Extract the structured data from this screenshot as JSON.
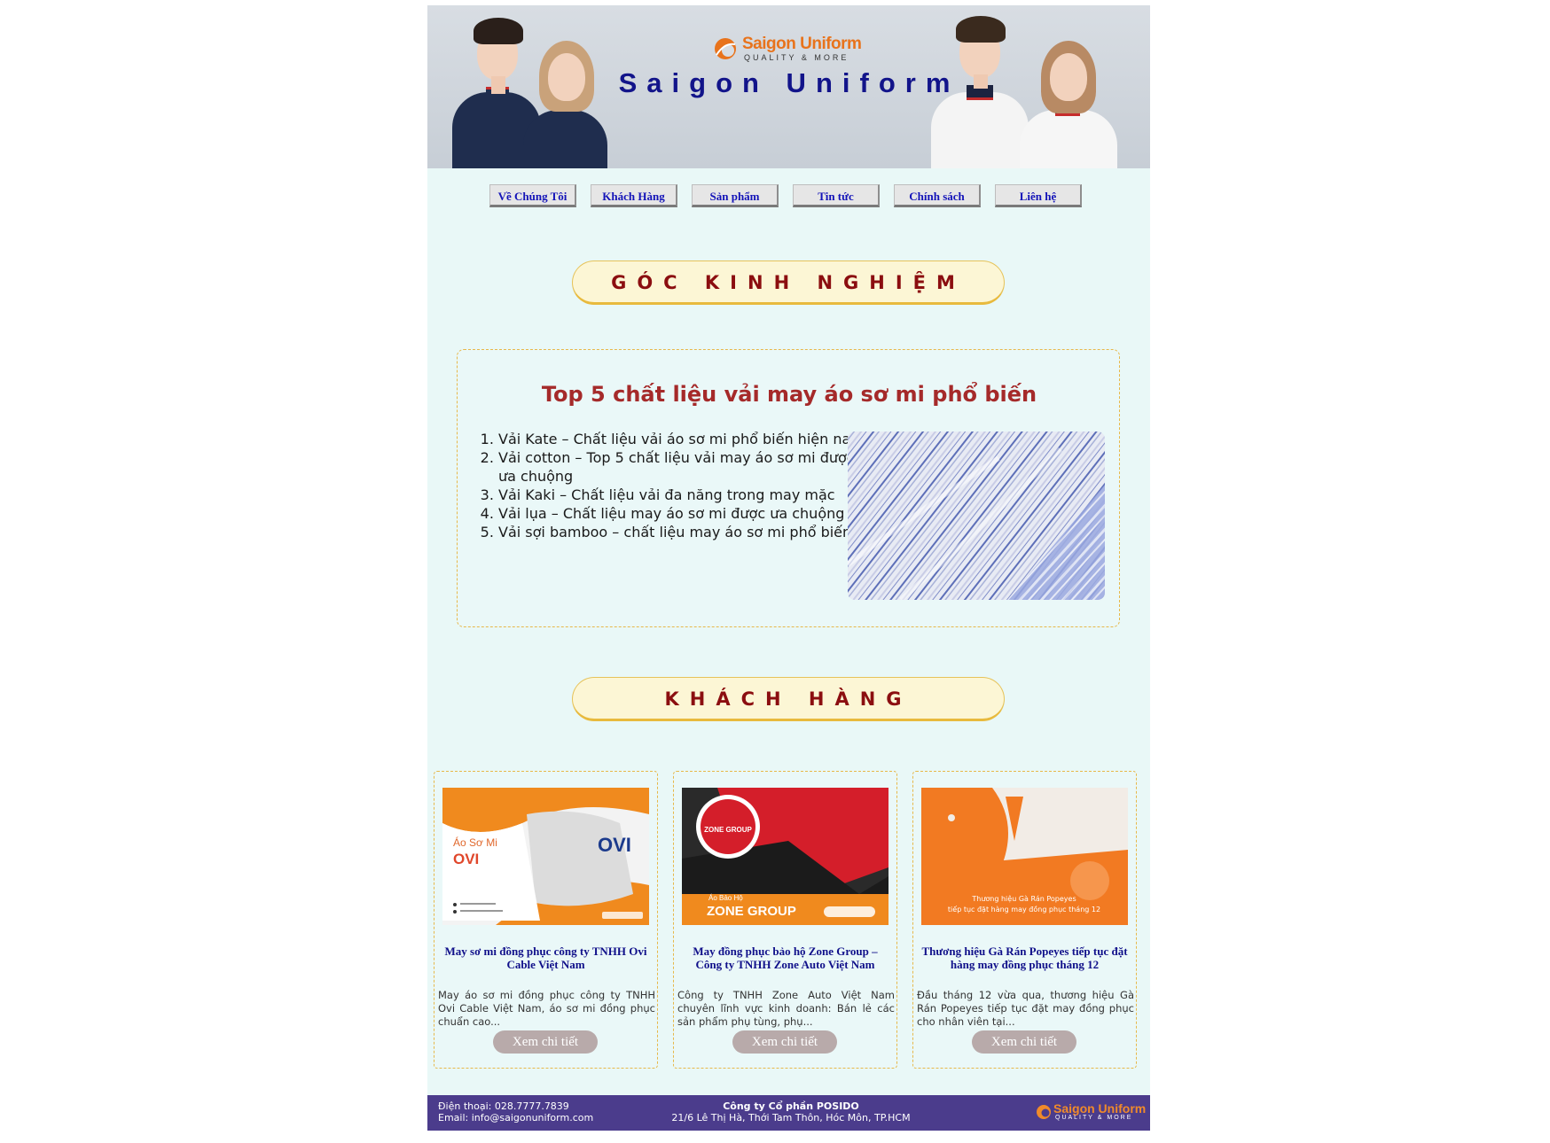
{
  "banner": {
    "logo_text": "Saigon Uniform",
    "logo_tagline": "QUALITY & MORE",
    "site_title": "Saigon Uniform"
  },
  "nav": {
    "items": [
      {
        "label": "Về Chúng Tôi"
      },
      {
        "label": "Khách Hàng"
      },
      {
        "label": "Sản phẩm"
      },
      {
        "label": "Tin tức"
      },
      {
        "label": "Chính sách"
      },
      {
        "label": "Liên hệ"
      }
    ]
  },
  "experience": {
    "heading": "GÓC KINH NGHIỆM",
    "article_title": "Top 5 chất liệu vải may áo sơ mi phổ biến",
    "items": [
      "Vải Kate – Chất liệu vải áo sơ mi phổ biến hiện nay",
      "Vải cotton – Top 5 chất liệu vải may áo sơ mi được ưa chuộng",
      "Vải Kaki – Chất liệu vải đa năng trong may mặc",
      "Vải lụa – Chất liệu may áo sơ mi được ưa chuộng",
      "Vải sợi bamboo – chất liệu may áo sơ mi phổ biến"
    ]
  },
  "customers": {
    "heading": "KHÁCH HÀNG",
    "cards": [
      {
        "img_caption": "Áo Sơ Mi",
        "img_brand": "OVI",
        "img_logo": "OVI",
        "title": "May sơ mi đồng phục công ty TNHH Ovi Cable Việt Nam",
        "desc": "May áo sơ mi đồng phục công ty TNHH Ovi Cable Việt Nam, áo sơ mi đồng phục chuẩn cao...",
        "button": "Xem chi tiết"
      },
      {
        "img_badge": "ZONE GROUP",
        "img_caption": "Áo Bảo Hộ",
        "img_brand": "ZONE GROUP",
        "title": "May đồng phục bảo hộ Zone Group – Công ty TNHH Zone Auto Việt Nam",
        "desc": "Công ty TNHH Zone Auto Việt Nam chuyên lĩnh vực kinh doanh: Bán lẻ các sản phẩm phụ tùng, phụ...",
        "button": "Xem chi tiết"
      },
      {
        "img_caption_1": "Thương hiệu Gà Rán Popeyes",
        "img_caption_2": "tiếp tục đặt hàng may đồng phục tháng 12",
        "title": "Thương hiệu Gà Rán Popeyes tiếp tục đặt hàng may đồng phục tháng 12",
        "desc": "Đầu tháng 12 vừa qua, thương hiệu Gà Rán Popeyes tiếp tục đặt may đồng phục cho nhân viên tại...",
        "button": "Xem chi tiết"
      }
    ]
  },
  "footer": {
    "phone": "Điện thoại: 028.7777.7839",
    "email": "Email: info@saigonuniform.com",
    "company": "Công ty Cổ phần POSIDO",
    "address": "21/6 Lê Thị Hà, Thới Tam Thôn, Hóc Môn, TP.HCM",
    "logo_text": "Saigon Uniform",
    "logo_tagline": "QUALITY & MORE"
  },
  "colors": {
    "page_bg": "#e9f8f7",
    "nav_text": "#1313b8",
    "heading_text": "#8b0e10",
    "pill_bg": "#fcf6d5",
    "footer_bg": "#4b3c8c",
    "accent_orange": "#e8731c"
  }
}
